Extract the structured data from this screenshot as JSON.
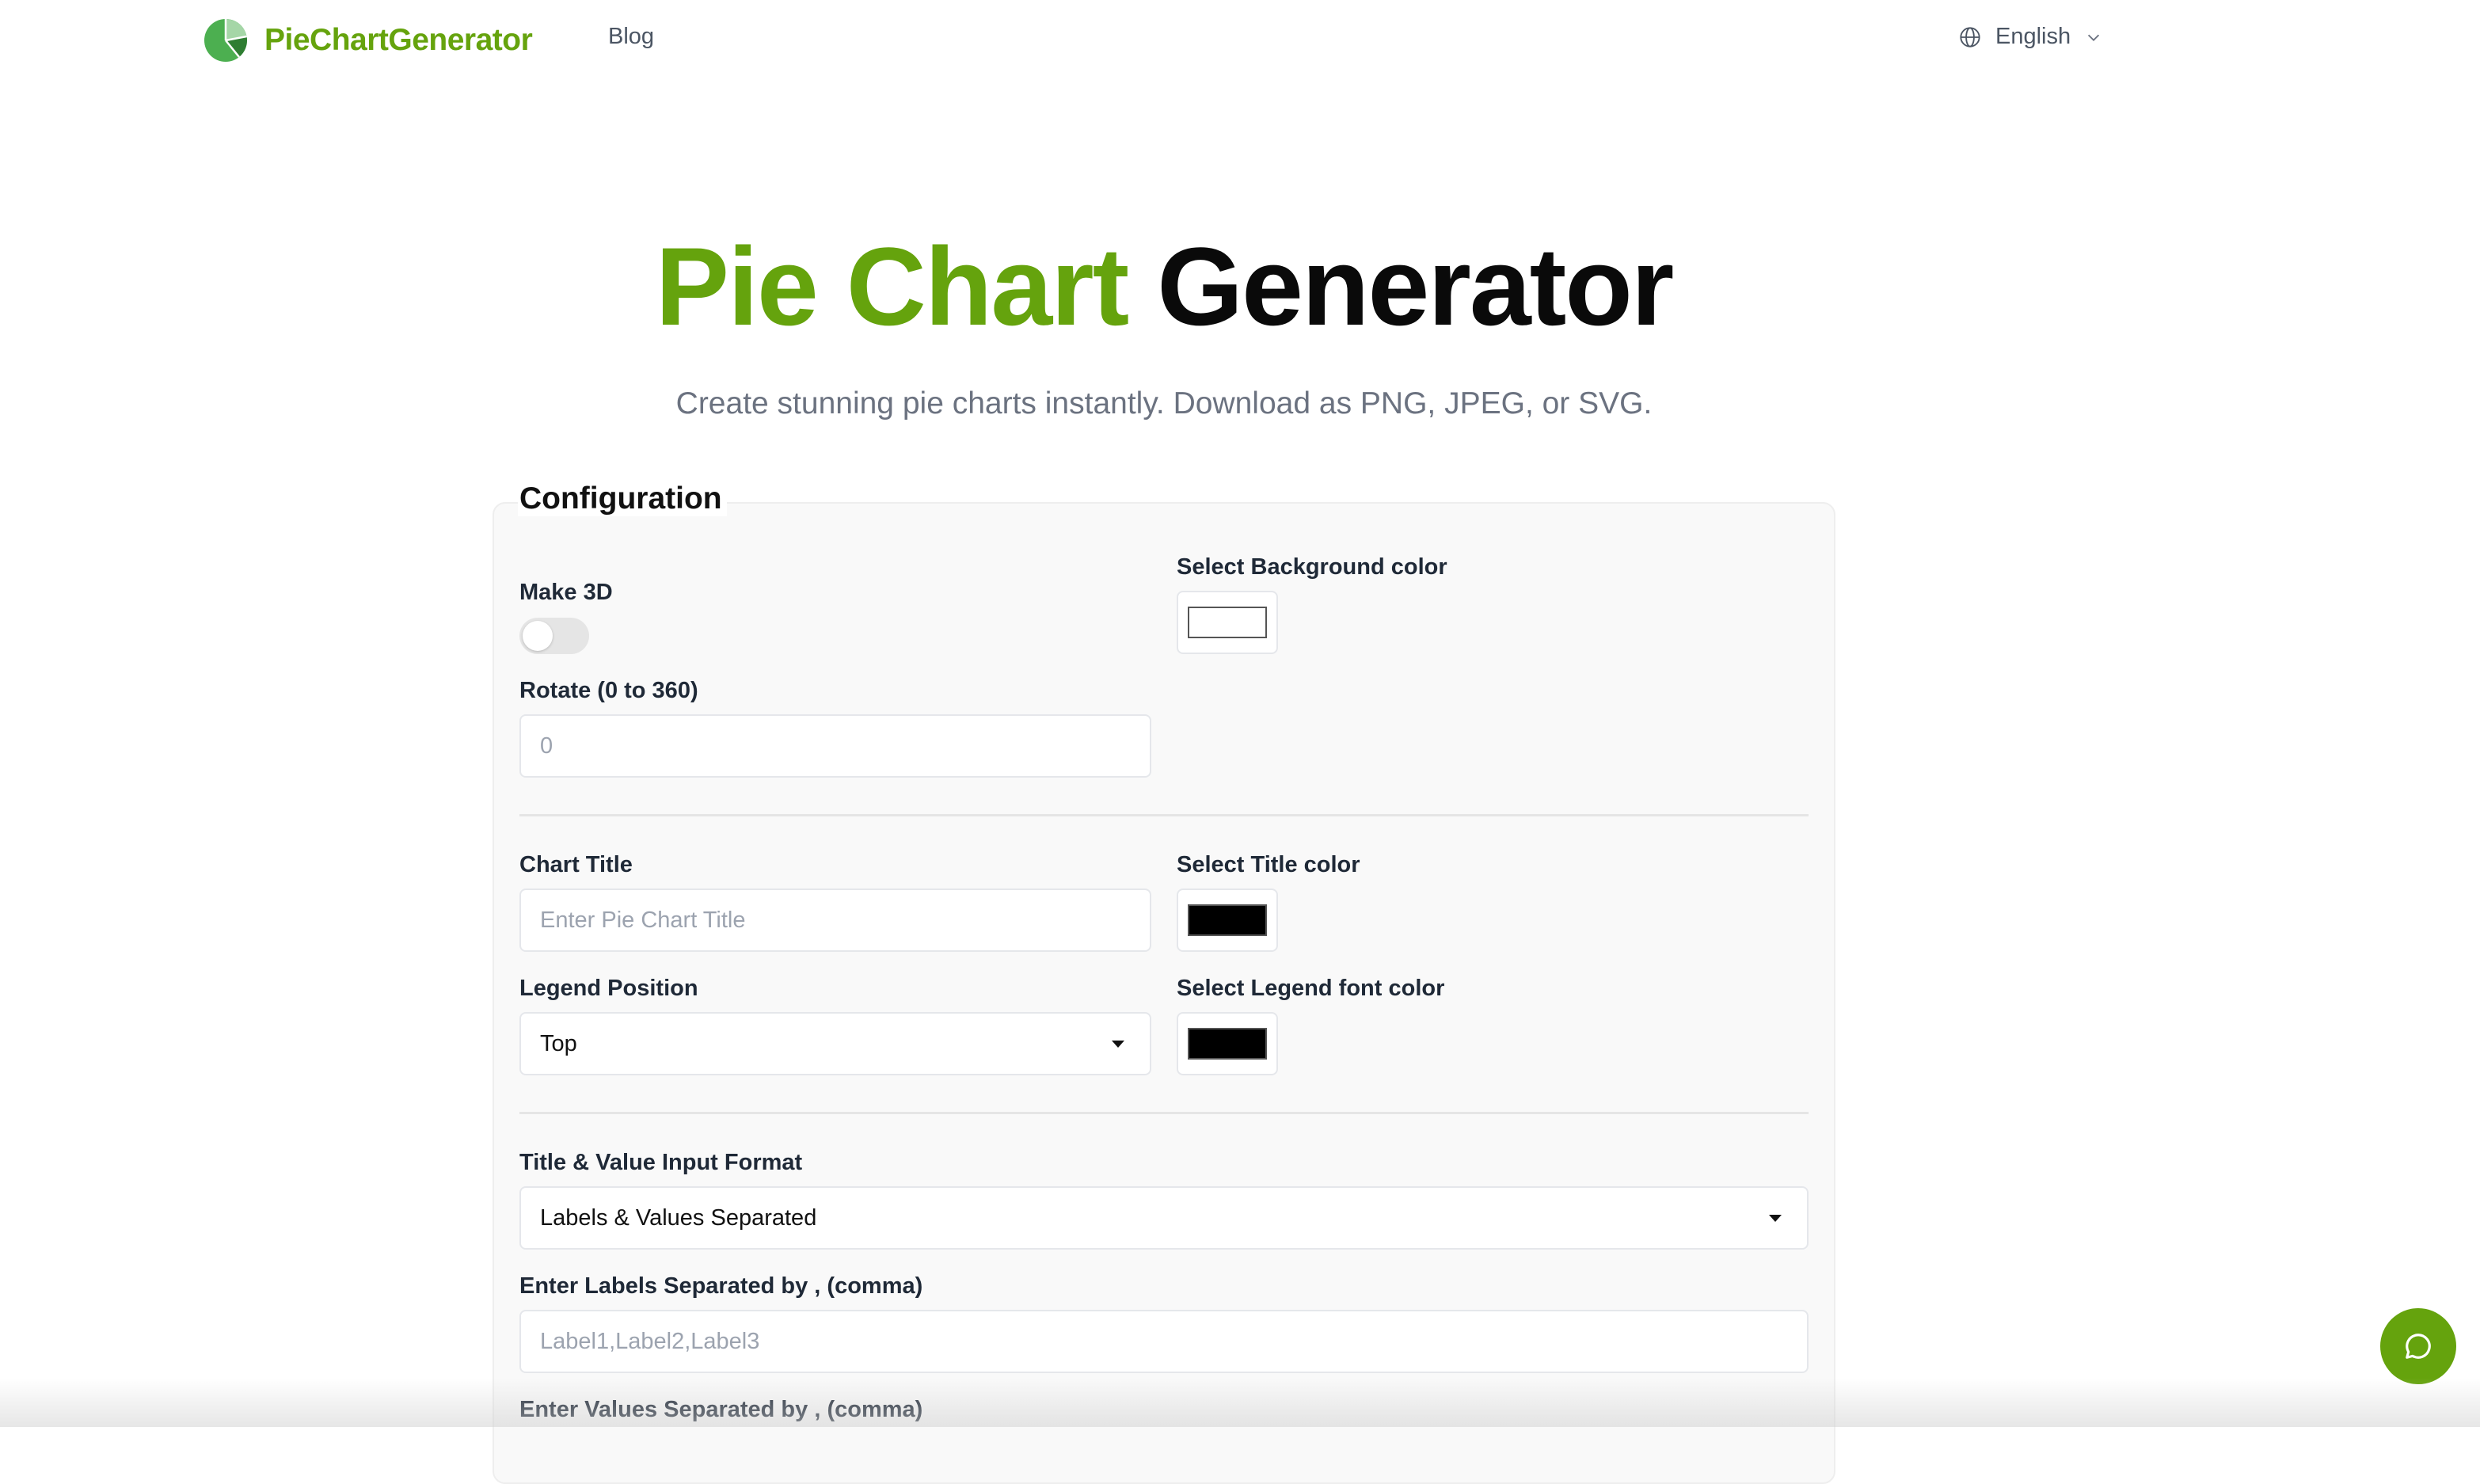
{
  "header": {
    "logo_text": "PieChartGenerator",
    "nav_blog": "Blog",
    "language": "English"
  },
  "hero": {
    "title_green": "Pie Chart",
    "title_black": "Generator",
    "subtitle": "Create stunning pie charts instantly. Download as PNG, JPEG, or SVG."
  },
  "config": {
    "title": "Configuration",
    "make3d_label": "Make 3D",
    "make3d_on": false,
    "rotate_label": "Rotate (0 to 360)",
    "rotate_placeholder": "0",
    "bg_color_label": "Select Background color",
    "bg_color": "#ffffff",
    "chart_title_label": "Chart Title",
    "chart_title_placeholder": "Enter Pie Chart Title",
    "title_color_label": "Select Title color",
    "title_color": "#000000",
    "legend_position_label": "Legend Position",
    "legend_position_value": "Top",
    "legend_color_label": "Select Legend font color",
    "legend_color": "#000000",
    "input_format_label": "Title & Value Input Format",
    "input_format_value": "Labels & Values Separated",
    "labels_label": "Enter Labels Separated by , (comma)",
    "labels_placeholder": "Label1,Label2,Label3",
    "values_label": "Enter Values Separated by , (comma)"
  },
  "colors": {
    "brand": "#65a30d"
  },
  "icons": {
    "logo": "pie-chart-logo-icon",
    "language": "globe-icon",
    "language_chevron": "chevron-down-icon",
    "chat": "chat-bubble-icon"
  }
}
